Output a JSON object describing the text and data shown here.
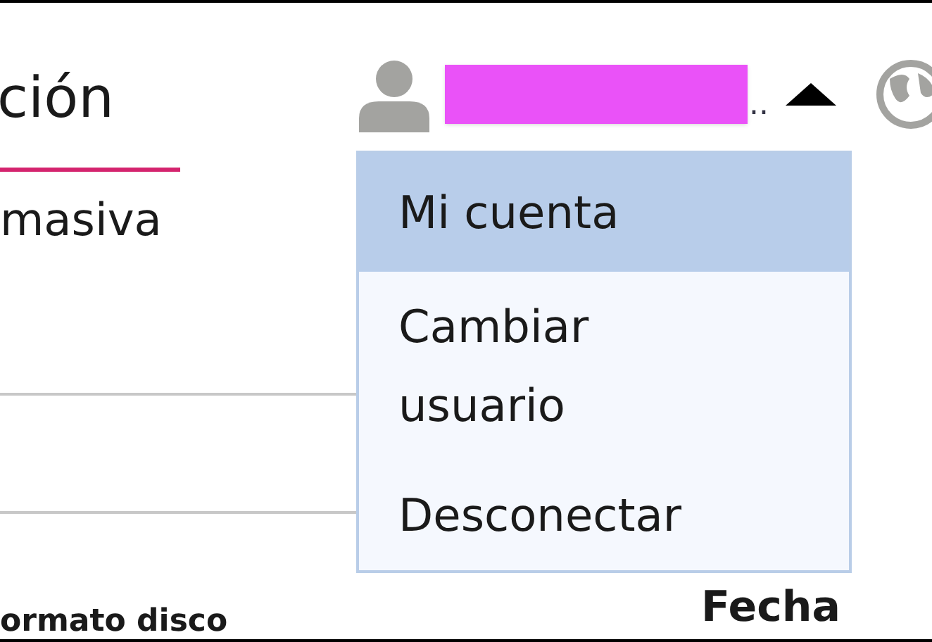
{
  "page_title": "ción",
  "tab": {
    "label": "masiva",
    "selected": false
  },
  "user_menu": {
    "username": "..",
    "expanded": true,
    "items": [
      {
        "label": "Mi cuenta",
        "selected": true
      },
      {
        "label": "Cambiar usuario",
        "selected": false
      },
      {
        "label": "Desconectar",
        "selected": false
      }
    ]
  },
  "column_header": "Fecha",
  "section_label": "ormato disco"
}
